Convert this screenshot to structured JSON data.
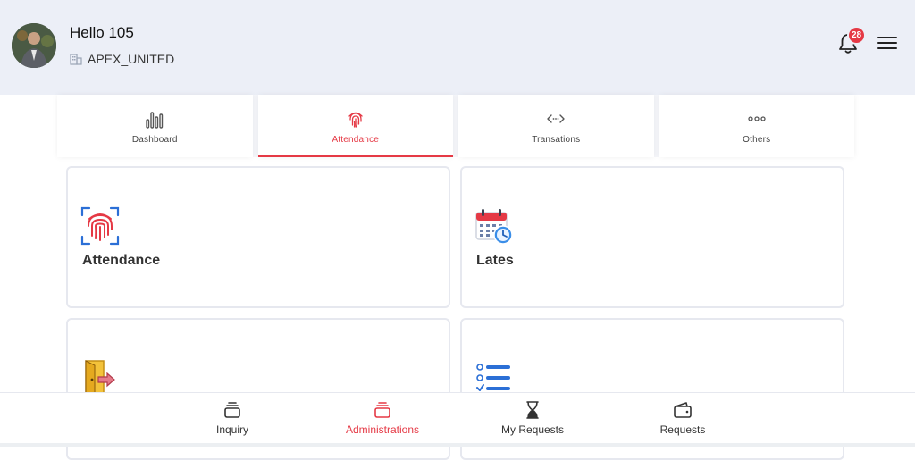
{
  "header": {
    "greeting": "Hello 105",
    "company": "APEX_UNITED",
    "notification_count": "28",
    "icons": {
      "avatar": "avatar",
      "company": "building-icon",
      "notifications": "bell-icon",
      "menu": "hamburger-menu-icon"
    }
  },
  "tabs": [
    {
      "label": "Dashboard",
      "icon": "bar-chart-icon",
      "active": false
    },
    {
      "label": "Attendance",
      "icon": "fingerprint-icon",
      "active": true
    },
    {
      "label": "Transations",
      "icon": "code-arrows-icon",
      "active": false
    },
    {
      "label": "Others",
      "icon": "more-dots-icon",
      "active": false
    }
  ],
  "cards": [
    {
      "title": "Attendance",
      "icon": "fingerprint-scan-icon"
    },
    {
      "title": "Lates",
      "icon": "calendar-clock-icon"
    },
    {
      "title": "",
      "icon": "door-exit-icon"
    },
    {
      "title": "",
      "icon": "checklist-icon"
    }
  ],
  "bottom_nav": [
    {
      "label": "Inquiry",
      "icon": "stack-icon",
      "active": false
    },
    {
      "label": "Administrations",
      "icon": "stack-icon",
      "active": true
    },
    {
      "label": "My Requests",
      "icon": "hourglass-icon",
      "active": false
    },
    {
      "label": "Requests",
      "icon": "wallet-icon",
      "active": false
    }
  ],
  "colors": {
    "accent": "#e53945",
    "header_bg": "#eceff7",
    "card_border": "#e6e8ef"
  }
}
